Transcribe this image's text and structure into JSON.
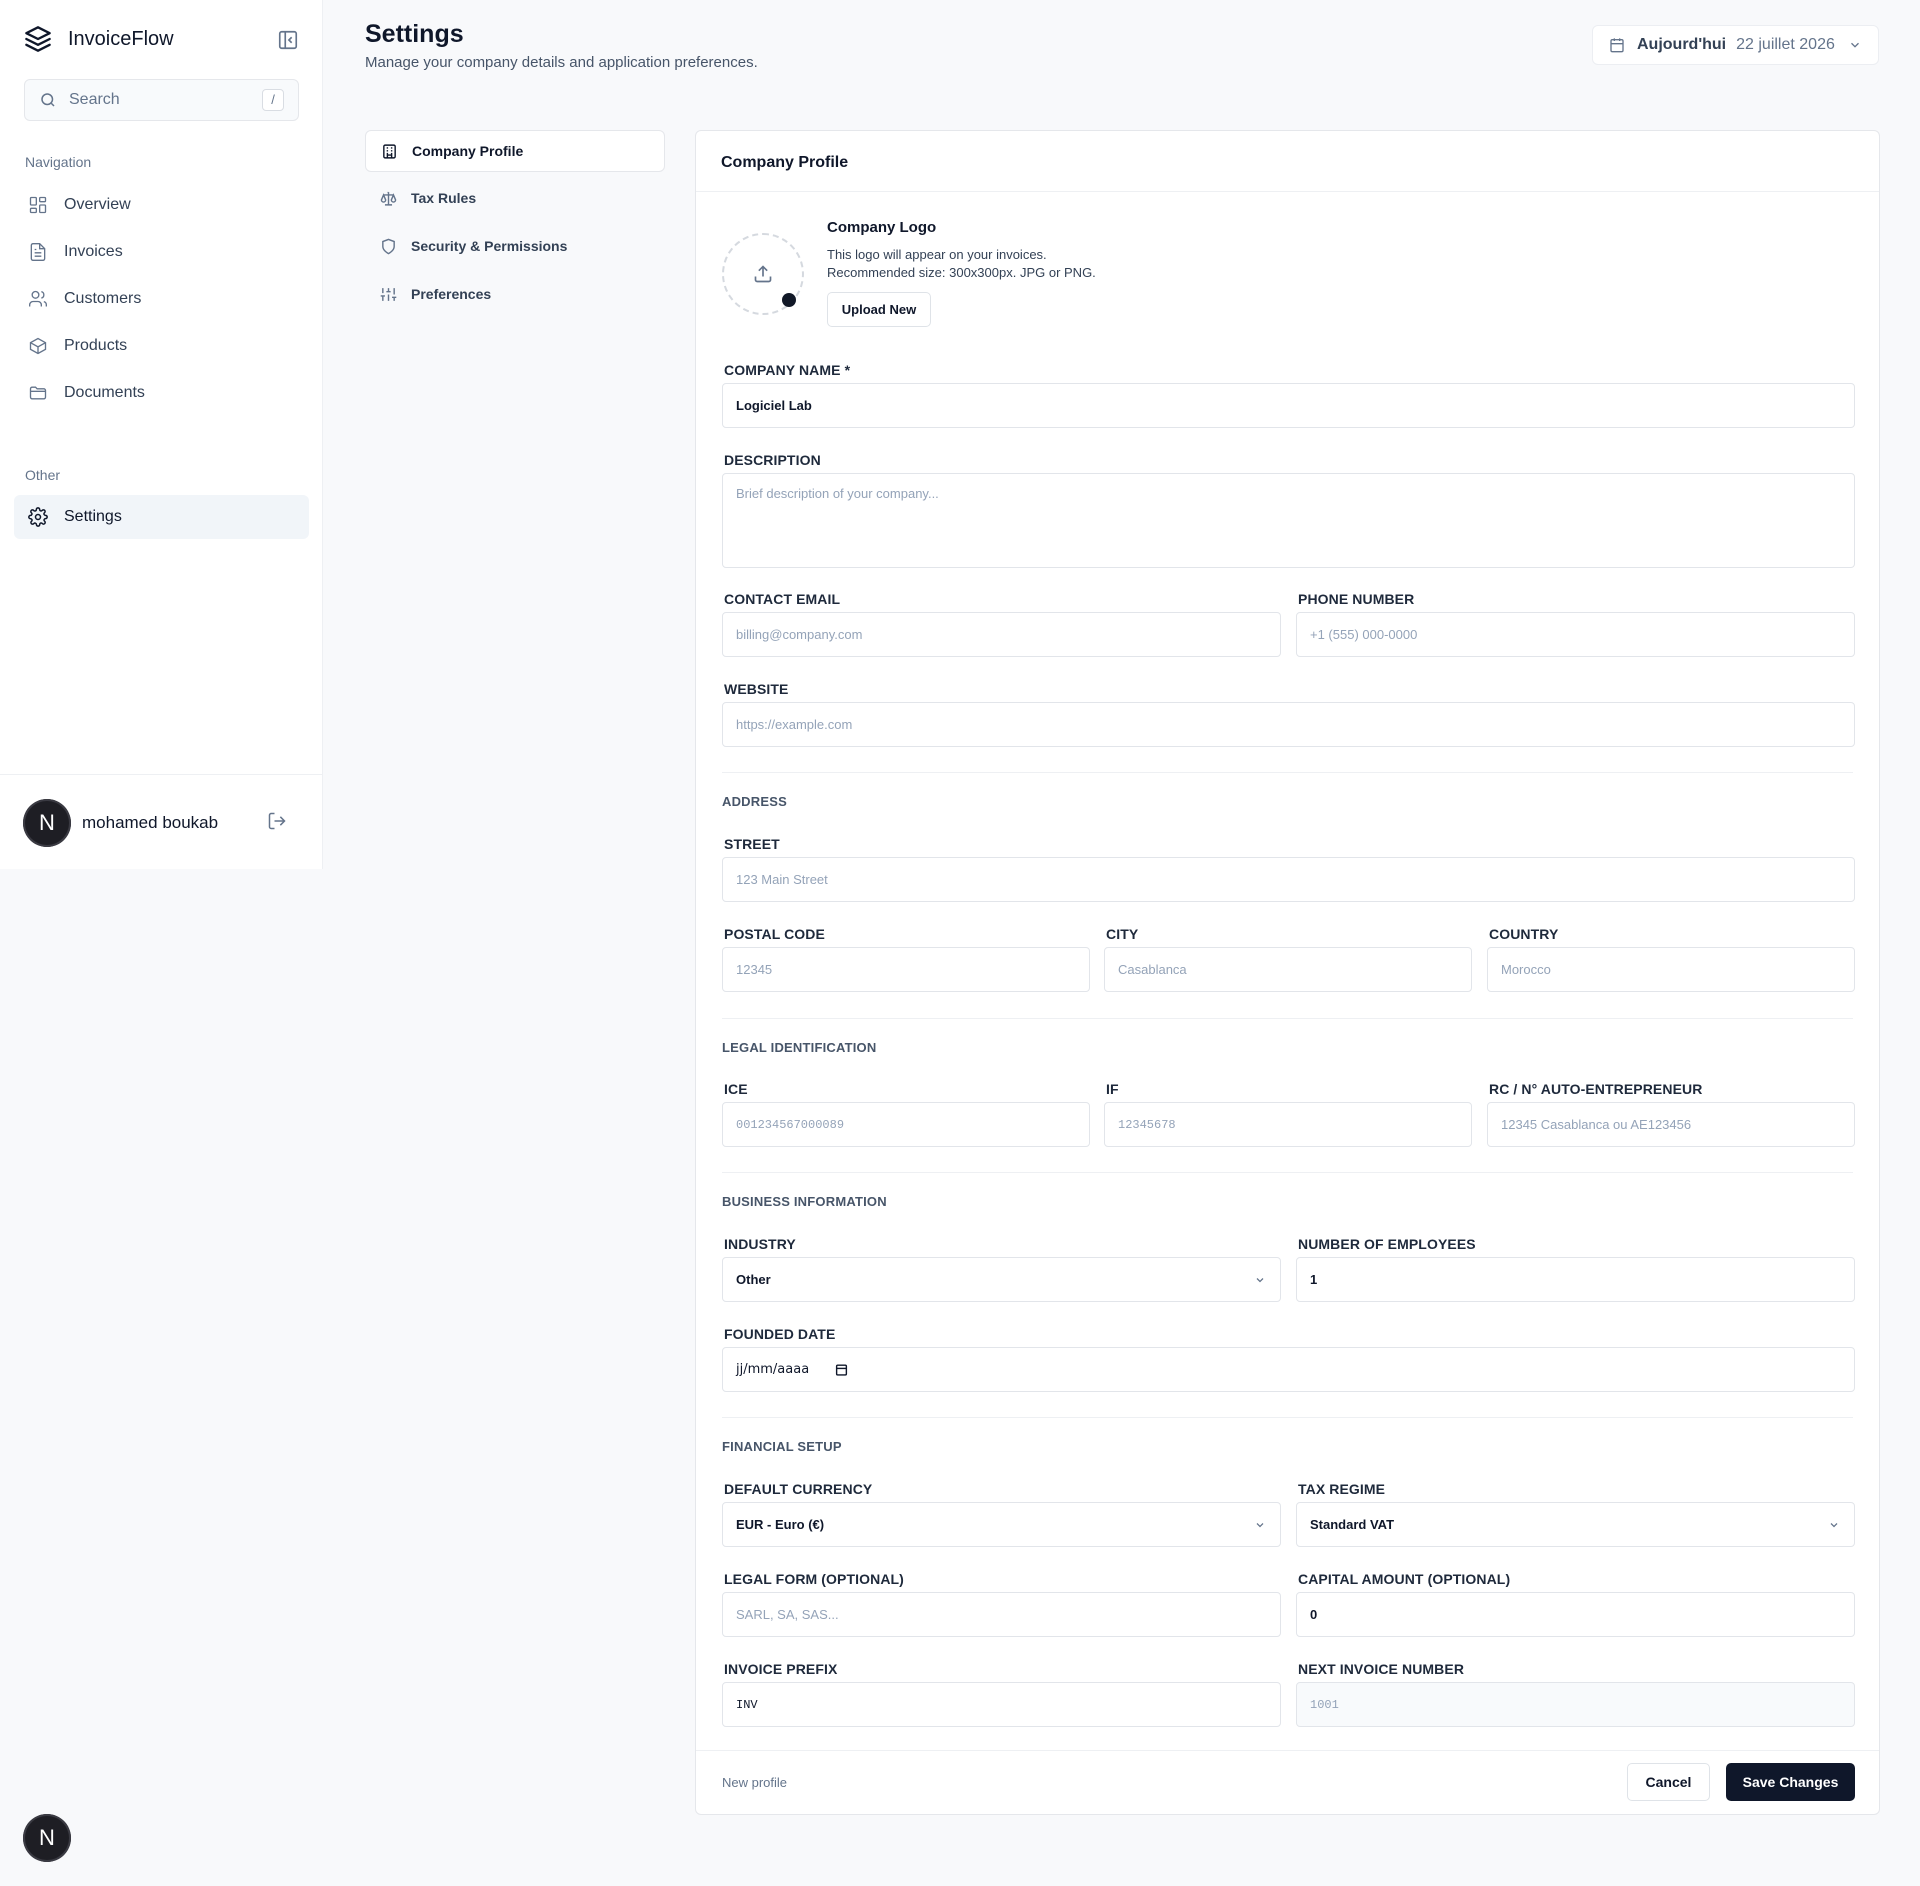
{
  "app": {
    "name": "InvoiceFlow",
    "search_placeholder": "Search",
    "search_shortcut": "/"
  },
  "sidebar": {
    "navigation_label": "Navigation",
    "items": [
      {
        "label": "Overview",
        "icon": "grid-icon"
      },
      {
        "label": "Invoices",
        "icon": "file-icon"
      },
      {
        "label": "Customers",
        "icon": "users-icon"
      },
      {
        "label": "Products",
        "icon": "box-icon"
      },
      {
        "label": "Documents",
        "icon": "folder-icon"
      }
    ],
    "other_label": "Other",
    "settings_label": "Settings"
  },
  "user": {
    "initial": "N",
    "name": "mohamed boukab"
  },
  "header": {
    "title": "Settings",
    "subtitle": "Manage your company details and application preferences.",
    "date_label": "Aujourd'hui",
    "date_value": "22 juillet 2026"
  },
  "settings_nav": [
    {
      "label": "Company Profile",
      "icon": "building-icon",
      "active": true
    },
    {
      "label": "Tax Rules",
      "icon": "scale-icon"
    },
    {
      "label": "Security & Permissions",
      "icon": "shield-icon"
    },
    {
      "label": "Preferences",
      "icon": "sliders-icon"
    }
  ],
  "card": {
    "title": "Company Profile",
    "logo": {
      "title": "Company Logo",
      "line1": "This logo will appear on your invoices.",
      "line2": "Recommended size: 300x300px. JPG or PNG.",
      "button": "Upload New"
    },
    "fields": {
      "company_name": {
        "label": "COMPANY NAME *",
        "value": "Logiciel Lab"
      },
      "description": {
        "label": "DESCRIPTION",
        "placeholder": "Brief description of your company..."
      },
      "contact_email": {
        "label": "CONTACT EMAIL",
        "placeholder": "billing@company.com"
      },
      "phone": {
        "label": "PHONE NUMBER",
        "placeholder": "+1 (555) 000-0000"
      },
      "website": {
        "label": "WEBSITE",
        "placeholder": "https://example.com"
      }
    },
    "address": {
      "title": "ADDRESS",
      "street": {
        "label": "STREET",
        "placeholder": "123 Main Street"
      },
      "postal": {
        "label": "POSTAL CODE",
        "placeholder": "12345"
      },
      "city": {
        "label": "CITY",
        "placeholder": "Casablanca"
      },
      "country": {
        "label": "COUNTRY",
        "placeholder": "Morocco"
      }
    },
    "legal": {
      "title": "LEGAL IDENTIFICATION",
      "ice": {
        "label": "ICE",
        "placeholder": "001234567000089"
      },
      "if": {
        "label": "IF",
        "placeholder": "12345678"
      },
      "rc": {
        "label": "RC / N° AUTO-ENTREPRENEUR",
        "placeholder": "12345 Casablanca ou AE123456"
      }
    },
    "business": {
      "title": "BUSINESS INFORMATION",
      "industry": {
        "label": "INDUSTRY",
        "value": "Other"
      },
      "employees": {
        "label": "NUMBER OF EMPLOYEES",
        "value": "1"
      },
      "founded": {
        "label": "FOUNDED DATE",
        "value": "jj/mm/aaaa"
      }
    },
    "financial": {
      "title": "FINANCIAL SETUP",
      "currency": {
        "label": "DEFAULT CURRENCY",
        "value": "EUR - Euro (€)"
      },
      "tax_regime": {
        "label": "TAX REGIME",
        "value": "Standard VAT"
      },
      "legal_form": {
        "label": "LEGAL FORM (OPTIONAL)",
        "placeholder": "SARL, SA, SAS..."
      },
      "capital": {
        "label": "CAPITAL AMOUNT (OPTIONAL)",
        "value": "0"
      },
      "prefix": {
        "label": "INVOICE PREFIX",
        "value": "INV"
      },
      "next_number": {
        "label": "NEXT INVOICE NUMBER",
        "value": "1001"
      }
    },
    "footer": {
      "note": "New profile",
      "cancel": "Cancel",
      "save": "Save Changes"
    }
  }
}
